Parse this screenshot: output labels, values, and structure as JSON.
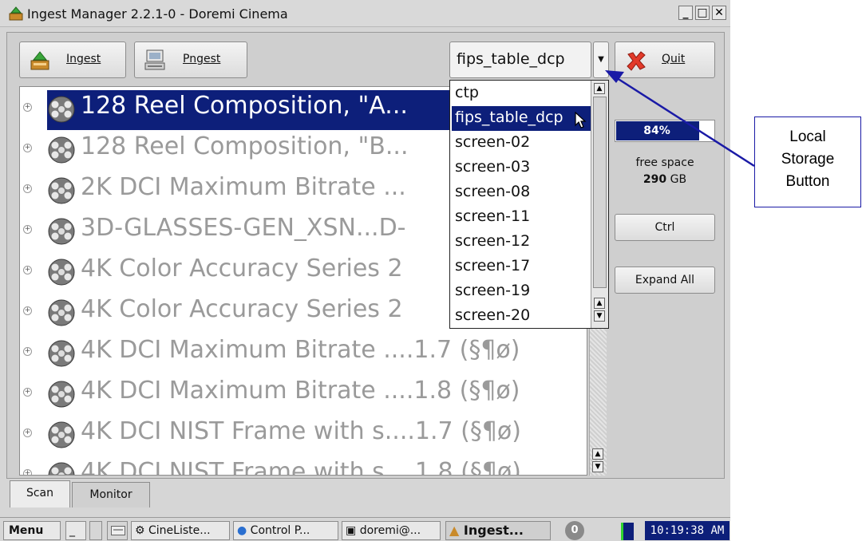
{
  "window": {
    "title": "Ingest Manager 2.2.1-0 - Doremi Cinema",
    "min_label": "_",
    "max_label": "□",
    "close_label": "✕"
  },
  "toolbar": {
    "ingest_label": "Ingest",
    "pngest_label": "Pngest",
    "quit_label": "Quit",
    "storage_value": "fips_table_dcp"
  },
  "content_list": [
    {
      "label": "128 Reel Composition, \"A...",
      "selected": true
    },
    {
      "label": "128 Reel Composition, \"B...",
      "selected": false
    },
    {
      "label": "2K DCI Maximum Bitrate ...",
      "selected": false
    },
    {
      "label": "3D-GLASSES-GEN_XSN...D-",
      "selected": false
    },
    {
      "label": "4K Color Accuracy Series 2",
      "selected": false
    },
    {
      "label": "4K Color Accuracy Series 2",
      "selected": false
    },
    {
      "label": "4K DCI Maximum Bitrate ....1.7 (§¶ø)",
      "selected": false
    },
    {
      "label": "4K DCI Maximum Bitrate ....1.8 (§¶ø)",
      "selected": false
    },
    {
      "label": "4K DCI NIST Frame with s....1.7 (§¶ø)",
      "selected": false
    },
    {
      "label": "4K DCI NIST Frame with s....1.8 (§¶ø)",
      "selected": false
    }
  ],
  "storage_options": [
    "ctp",
    "fips_table_dcp",
    "screen-02",
    "screen-03",
    "screen-08",
    "screen-11",
    "screen-12",
    "screen-17",
    "screen-19",
    "screen-20"
  ],
  "storage_selected_index": 1,
  "disk": {
    "percent_label": "84%",
    "percent_value": 0.84,
    "free_label": "free space",
    "free_amount": "290",
    "free_unit": "GB"
  },
  "side_buttons": {
    "ctrl_label": "Ctrl",
    "expand_label": "Expand All"
  },
  "tabs": [
    "Scan",
    "Monitor"
  ],
  "taskbar": {
    "menu_label": "Menu",
    "minimize_label": "_",
    "items": [
      "CineListe...",
      "Control P...",
      "doremi@...",
      "Ingest..."
    ],
    "badge": "0",
    "clock": "10:19:38 AM"
  },
  "annotation": {
    "line1": "Local",
    "line2": "Storage",
    "line3": "Button"
  },
  "colors": {
    "selection": "#0d1f7a",
    "annotation_arrow": "#1a1aa6"
  }
}
